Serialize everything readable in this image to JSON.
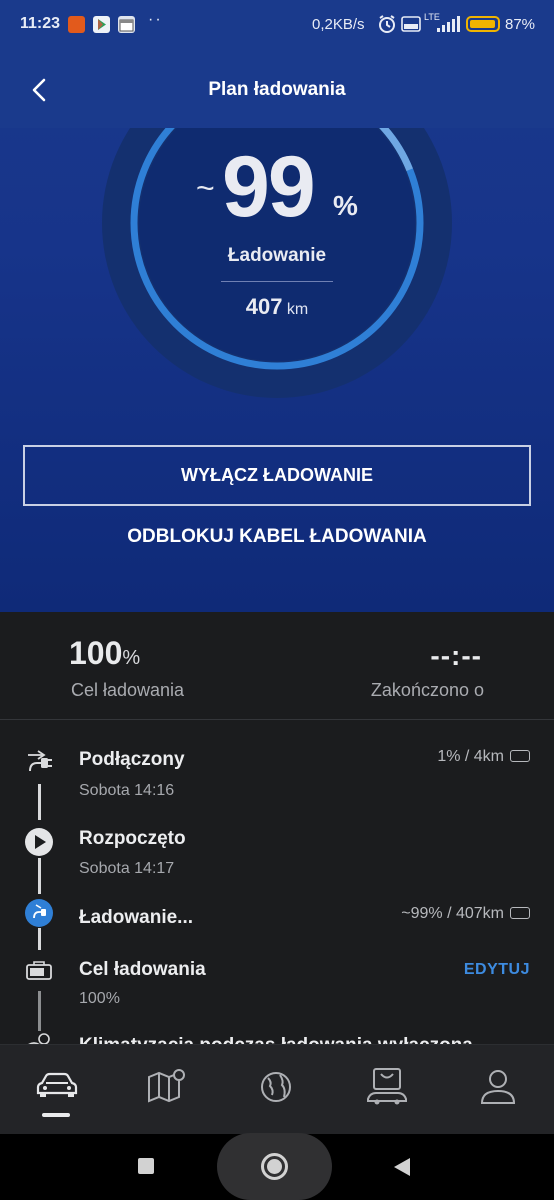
{
  "status_bar": {
    "time": "11:23",
    "dots": "··",
    "network_speed": "0,2KB/s",
    "lte": "LTE",
    "battery_percent": "87%",
    "battery_color": "#f0b400"
  },
  "header": {
    "title": "Plan ładowania",
    "back_icon": "chevron-left-icon"
  },
  "gauge": {
    "tilde": "~",
    "percent_value": "99",
    "percent_sign": "%",
    "state_label": "Ładowanie",
    "range_value": "407",
    "range_unit": "km",
    "fill_fraction": 0.99,
    "accent_color": "#3a86d8"
  },
  "actions": {
    "stop_charging": "WYŁĄCZ ŁADOWANIE",
    "unlock_cable": "ODBLOKUJ KABEL ŁADOWANIA"
  },
  "stats": {
    "target_value": "100",
    "target_unit": "%",
    "target_label": "Cel ładowania",
    "finish_value": "--:--",
    "finish_label": "Zakończono o"
  },
  "timeline": [
    {
      "title": "Podłączony",
      "sub": "Sobota 14:16",
      "right": "1% / 4km",
      "icon": "plug-icon"
    },
    {
      "title": "Rozpoczęto",
      "sub": "Sobota 14:17",
      "right": "",
      "icon": "play-icon"
    },
    {
      "title": "Ładowanie...",
      "sub": "",
      "right": "~99% / 407km",
      "icon": "charging-icon"
    },
    {
      "title": "Cel ładowania",
      "sub": "100%",
      "right": "",
      "icon": "battery-target-icon",
      "action": "EDYTUJ"
    }
  ],
  "timeline_cut_text": "Klimatyzacja podczas ładowania wyłączona",
  "colors": {
    "top_background": "#17348a",
    "dark_background": "#1b1c1e",
    "edit_color": "#3d8be0"
  },
  "nav": [
    "car-icon",
    "map-icon",
    "globe-icon",
    "shop-icon",
    "profile-icon"
  ]
}
